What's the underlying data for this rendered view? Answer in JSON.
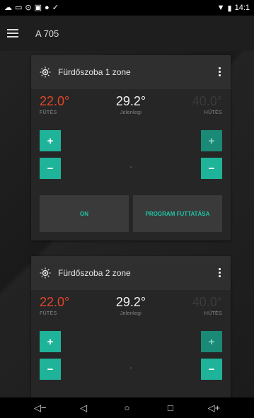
{
  "status_bar": {
    "left_icons": [
      "cloud-icon",
      "cast-icon",
      "circle-icon",
      "image-icon",
      "dot-icon",
      "check-icon"
    ],
    "time": "14:1"
  },
  "app_bar": {
    "title": "A 705"
  },
  "zones": [
    {
      "title": "Fürdőszoba 1 zone",
      "heating": {
        "value": "22.0°",
        "label": "FŰTÉS"
      },
      "current": {
        "value": "29.2°",
        "label": "Jelenlegi"
      },
      "cooling": {
        "value": "40.0°",
        "label": "HŰTÉS"
      },
      "center_dash": "-",
      "on_label": "ON",
      "program_label": "PROGRAM FUTTATÁSA"
    },
    {
      "title": "Fürdőszoba 2 zone",
      "heating": {
        "value": "22.0°",
        "label": "FŰTÉS"
      },
      "current": {
        "value": "29.2°",
        "label": "Jelenlegi"
      },
      "cooling": {
        "value": "40.0°",
        "label": "HŰTÉS"
      },
      "center_dash": "-"
    }
  ],
  "buttons": {
    "plus": "+",
    "minus": "−"
  },
  "colors": {
    "accent": "#1fb39a",
    "heat": "#e2452a",
    "cool_disabled": "#3b3b3b",
    "action_text": "#1fc6a7"
  },
  "nav_bar": {
    "vol_down": "◁−",
    "back": "◁",
    "home": "○",
    "recents": "□",
    "vol_up": "◁+"
  }
}
